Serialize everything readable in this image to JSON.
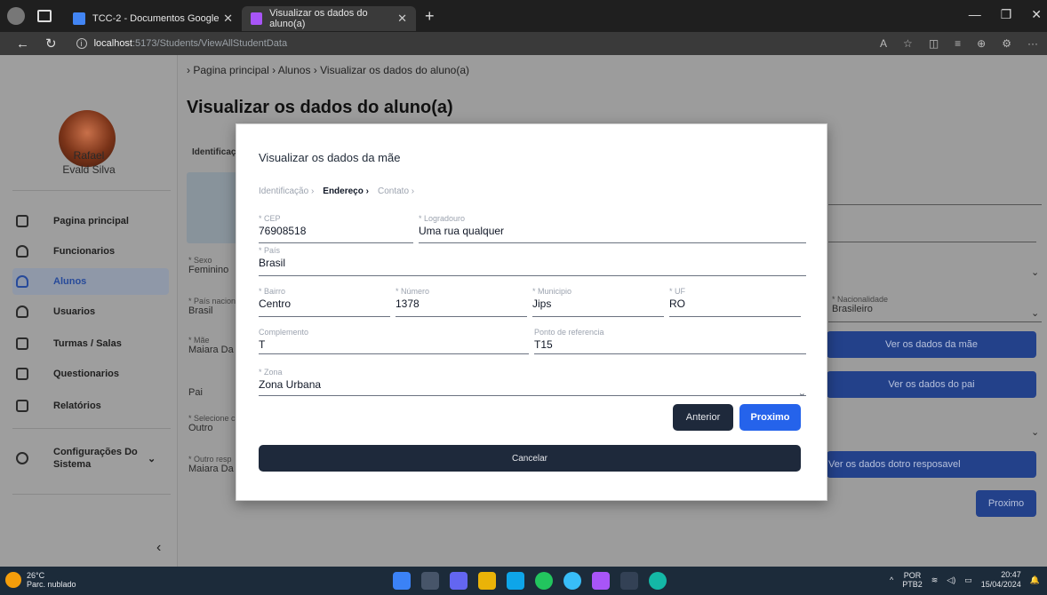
{
  "browser": {
    "tabs": [
      {
        "title": "TCC-2 - Documentos Google",
        "favicon_color": "#4285f4"
      },
      {
        "title": "Visualizar os dados do aluno(a)",
        "favicon_color": "#a855f7"
      }
    ],
    "url_host": "localhost",
    "url_rest": ":5173/Students/ViewAllStudentData"
  },
  "sidebar": {
    "user_first": "Rafael",
    "user_last": "Evald Silva",
    "items": [
      {
        "label": "Pagina principal",
        "icon": "grid-icon"
      },
      {
        "label": "Funcionarios",
        "icon": "user-icon"
      },
      {
        "label": "Alunos",
        "icon": "user-icon"
      },
      {
        "label": "Usuarios",
        "icon": "user-icon"
      },
      {
        "label": "Turmas / Salas",
        "icon": "document-icon"
      },
      {
        "label": "Questionarios",
        "icon": "document-icon"
      },
      {
        "label": "Relatórios",
        "icon": "document-icon"
      },
      {
        "label": "Configurações Do Sistema",
        "icon": "gear-icon"
      }
    ]
  },
  "breadcrumb": {
    "items": [
      "Pagina principal",
      "Alunos",
      "Visualizar os dados do aluno(a)"
    ]
  },
  "page": {
    "title": "Visualizar os dados do aluno(a)",
    "ident_label": "Identificaç",
    "sexo_label": "* Sexo",
    "sexo_value": "Feminino",
    "pais_nac_label": "* País nacion",
    "pais_nac_value": "Brasil",
    "mae_label": "* Mãe",
    "mae_value": "Maiara Da",
    "pai_value": "Pai",
    "selecione_label": "* Selecione c",
    "selecione_value": "Outro",
    "outro_label": "* Outro resp",
    "outro_value": "Maiara Da",
    "nacionalidade_label": "* Nacionalidade",
    "nacionalidade_value": "Brasileiro",
    "btn_mae": "Ver os dados da mãe",
    "btn_pai": "Ver os dados do pai",
    "btn_outro": "Ver os dados dotro resposavel",
    "btn_proximo": "Proximo"
  },
  "modal": {
    "title": "Visualizar os dados da mãe",
    "steps": [
      "Identificação",
      "Endereço",
      "Contato"
    ],
    "active_step": 1,
    "fields": {
      "cep": {
        "label": "* CEP",
        "value": "76908518"
      },
      "logradouro": {
        "label": "* Logradouro",
        "value": "Uma rua qualquer"
      },
      "pais": {
        "label": "* País",
        "value": "Brasil"
      },
      "bairro": {
        "label": "* Bairro",
        "value": "Centro"
      },
      "numero": {
        "label": "* Número",
        "value": "1378"
      },
      "municipio": {
        "label": "* Municipio",
        "value": "Jips"
      },
      "uf": {
        "label": "* UF",
        "value": "RO"
      },
      "complemento": {
        "label": "Complemento",
        "value": "T"
      },
      "ponto_ref": {
        "label": "Ponto de referencia",
        "value": "T15"
      },
      "zona": {
        "label": "* Zona",
        "value": "Zona Urbana"
      }
    },
    "btn_anterior": "Anterior",
    "btn_proximo": "Proximo",
    "btn_cancelar": "Cancelar"
  },
  "taskbar": {
    "temp": "26°C",
    "weather": "Parc. nublado",
    "lang1": "POR",
    "lang2": "PTB2",
    "time": "20:47",
    "date": "15/04/2024"
  }
}
